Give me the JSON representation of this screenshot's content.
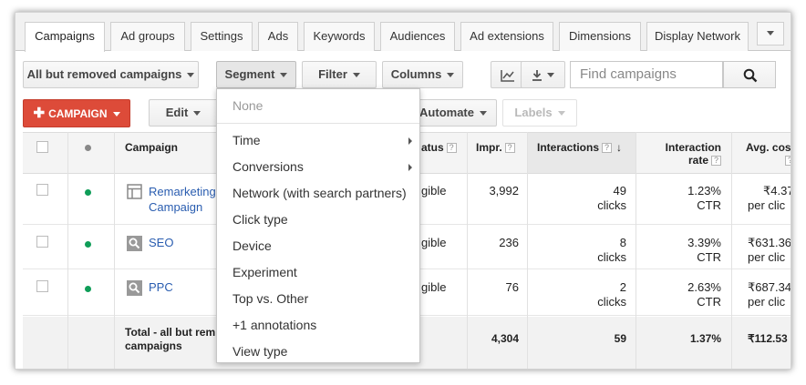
{
  "tabs": [
    {
      "label": "Campaigns",
      "active": true
    },
    {
      "label": "Ad groups"
    },
    {
      "label": "Settings"
    },
    {
      "label": "Ads"
    },
    {
      "label": "Keywords"
    },
    {
      "label": "Audiences"
    },
    {
      "label": "Ad extensions"
    },
    {
      "label": "Dimensions"
    },
    {
      "label": "Display Network"
    }
  ],
  "toolbar": {
    "campaign_filter": "All but removed campaigns",
    "segment": "Segment",
    "filter": "Filter",
    "columns": "Columns",
    "chart_icon": "line-chart-icon",
    "download_icon": "download-icon",
    "search_placeholder": "Find campaigns",
    "search_icon": "magnifier-icon"
  },
  "actions": {
    "add_campaign": "CAMPAIGN",
    "edit": "Edit",
    "automate": "Automate",
    "labels": "Labels"
  },
  "table": {
    "headers": {
      "campaign": "Campaign",
      "status": "atus",
      "impr": "Impr.",
      "interactions": "Interactions",
      "interaction_rate_1": "Interaction",
      "interaction_rate_2": "rate",
      "avg_cost": "Avg. cos"
    },
    "rows": [
      {
        "name_1": "Remarketing",
        "name_2": "Campaign",
        "type_icon": "display-campaign-icon",
        "status": "gible",
        "impr": "3,992",
        "interactions": "49",
        "interactions_unit": "clicks",
        "rate": "1.23%",
        "rate_unit": "CTR",
        "cost": "₹4.37",
        "cost_unit": "per clic"
      },
      {
        "name_1": "SEO",
        "type_icon": "search-campaign-icon",
        "status": "gible",
        "impr": "236",
        "interactions": "8",
        "interactions_unit": "clicks",
        "rate": "3.39%",
        "rate_unit": "CTR",
        "cost": "₹631.36",
        "cost_unit": "per clic"
      },
      {
        "name_1": "PPC",
        "type_icon": "search-campaign-icon",
        "status": "gible",
        "impr": "76",
        "interactions": "2",
        "interactions_unit": "clicks",
        "rate": "2.63%",
        "rate_unit": "CTR",
        "cost": "₹687.34",
        "cost_unit": "per clic"
      }
    ],
    "total": {
      "label_1": "Total - all but rem",
      "label_2": "campaigns",
      "impr": "4,304",
      "interactions": "59",
      "rate": "1.37%",
      "cost": "₹112.53"
    }
  },
  "segment_menu": {
    "items": [
      {
        "label": "None",
        "disabled": true
      },
      {
        "label": "Time",
        "submenu": true
      },
      {
        "label": "Conversions",
        "submenu": true
      },
      {
        "label": "Network (with search partners)"
      },
      {
        "label": "Click type"
      },
      {
        "label": "Device"
      },
      {
        "label": "Experiment"
      },
      {
        "label": "Top vs. Other"
      },
      {
        "label": "+1 annotations"
      },
      {
        "label": "View type"
      }
    ]
  },
  "colors": {
    "add_button": "#dd4b39",
    "status_enabled": "#0f9d58",
    "link": "#2a5db0"
  }
}
